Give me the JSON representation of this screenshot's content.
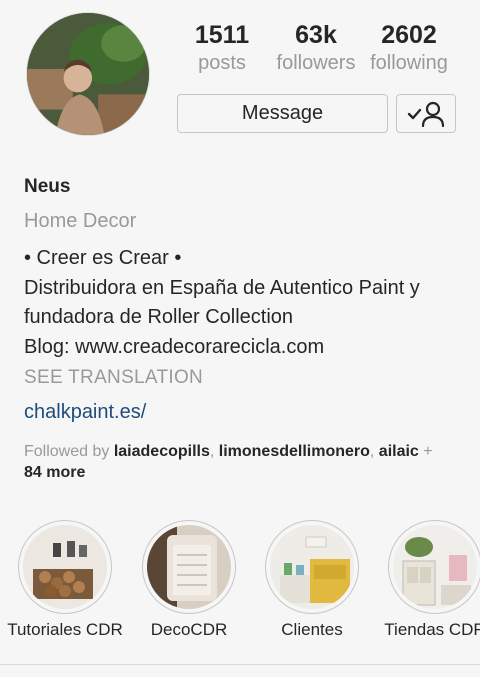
{
  "stats": {
    "posts_count": "1511",
    "posts_label": "posts",
    "followers_count": "63k",
    "followers_label": "followers",
    "following_count": "2602",
    "following_label": "following"
  },
  "buttons": {
    "message_label": "Message",
    "follow_icon": "following-check-icon"
  },
  "profile": {
    "name": "Neus",
    "category": "Home Decor",
    "bio_lines": [
      "• Creer es Crear •",
      "Distribuidora en España de Autentico Paint y",
      "fundadora de Roller Collection",
      "Blog: www.creadecorarecicla.com"
    ],
    "see_translation": "SEE TRANSLATION",
    "link": "chalkpaint.es/"
  },
  "followed_by": {
    "prefix": "Followed by ",
    "users": [
      "laiadecopills",
      "limonesdellimonero",
      "ailaic"
    ],
    "more": "84 more"
  },
  "highlights": [
    {
      "label": "Tutoriales CDR"
    },
    {
      "label": "DecoCDR"
    },
    {
      "label": "Clientes"
    },
    {
      "label": "Tiendas CDR"
    }
  ],
  "colors": {
    "link": "#1f4d7a",
    "muted": "#999999",
    "text": "#262626",
    "background": "#f6f6f6"
  }
}
